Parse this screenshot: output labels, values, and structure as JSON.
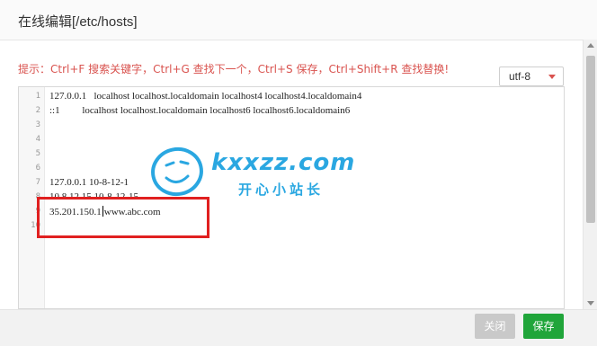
{
  "dialog": {
    "title": "在线编辑[/etc/hosts]",
    "tip": "提示：Ctrl+F 搜索关键字，Ctrl+G 查找下一个，Ctrl+S 保存，Ctrl+Shift+R 查找替换!",
    "encoding": "utf-8"
  },
  "editor": {
    "line_numbers": [
      "1",
      "2",
      "3",
      "4",
      "5",
      "6",
      "7",
      "8",
      "9",
      "10"
    ],
    "lines": [
      "127.0.0.1   localhost localhost.localdomain localhost4 localhost4.localdomain4",
      "::1         localhost localhost.localdomain localhost6 localhost6.localdomain6",
      "",
      "",
      "",
      "",
      "127.0.0.1 10-8-12-1",
      "10.8.12.15 10-8-12-15",
      "35.201.150.1",
      ""
    ],
    "cursor_line_after": "www.abc.com"
  },
  "watermark": {
    "domain": "kxxzz.com",
    "subtitle": "开心小站长"
  },
  "footer": {
    "close_label": "关闭",
    "save_label": "保存"
  },
  "colors": {
    "tip": "#d9534f",
    "save": "#20a53a",
    "close": "#c9c9c9",
    "highlight": "#e02020",
    "watermark": "#1fa3e0"
  }
}
